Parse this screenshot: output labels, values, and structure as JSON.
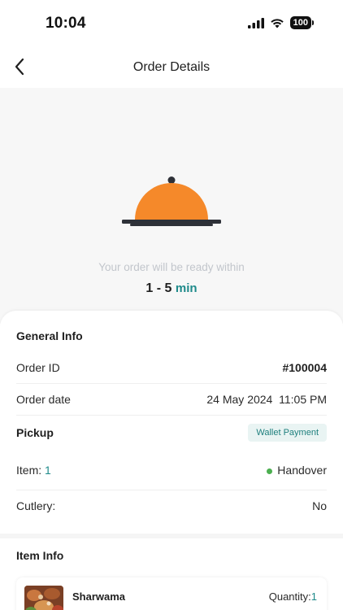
{
  "status_bar": {
    "time": "10:04",
    "battery": "100"
  },
  "header": {
    "title": "Order Details"
  },
  "hero": {
    "ready_text": "Your order will be ready within",
    "ready_range": "1 - 5",
    "ready_unit": "min"
  },
  "general_info": {
    "title": "General Info",
    "order_id_label": "Order ID",
    "order_id_value": "#100004",
    "order_date_label": "Order date",
    "order_date_value": "24 May 2024  11:05 PM",
    "order_type": "Pickup",
    "payment_badge": "Wallet Payment",
    "item_label": "Item:",
    "item_count": "1",
    "item_status": "Handover",
    "cutlery_label": "Cutlery:",
    "cutlery_value": "No"
  },
  "item_info": {
    "title": "Item Info",
    "items": [
      {
        "name": "Sharwama",
        "quantity_label": "Quantity:",
        "quantity": "1"
      }
    ]
  },
  "colors": {
    "accent": "#1e8a8a",
    "cloche": "#f5892a",
    "tray": "#2e3138",
    "badge_bg": "#e9f4f3",
    "handover_dot": "#4caf50"
  }
}
